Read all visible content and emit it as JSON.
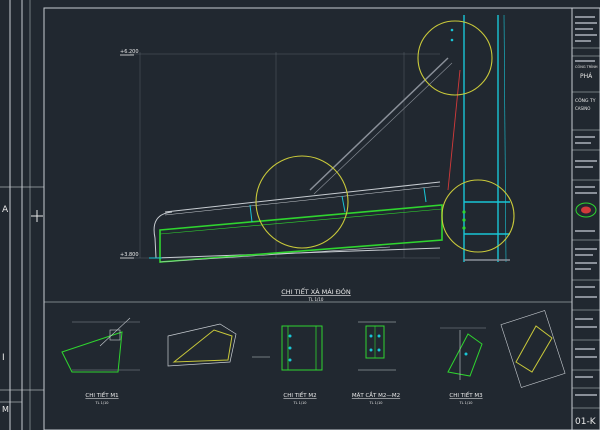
{
  "app": {
    "background": "#212830"
  },
  "colors": {
    "frame": "#c8cdd2",
    "beam_green": "#2fd52f",
    "detail_circle": "#c9c93a",
    "column_cyan": "#19c6d6",
    "tie_red": "#d23a3a",
    "text_white": "#e8e8e8",
    "dim_gray": "#8a9099"
  },
  "main_drawing": {
    "title": "CHI TIẾT XÀ MÁI ĐÓN",
    "scale": "TL 1/10",
    "level_top": "+6.200",
    "level_bottom": "+3.800"
  },
  "detail_views": [
    {
      "title": "CHI TIẾT M1",
      "scale": "TL 1/10"
    },
    {
      "title": "CHI TIẾT M2",
      "scale": "TL 1/10"
    },
    {
      "title": "MẶT CẮT M2—M2",
      "scale": "TL 1/10"
    },
    {
      "title": "CHI TIẾT M3",
      "scale": "TL 1/10"
    }
  ],
  "title_block": {
    "project_label": "CÔNG TRÌNH",
    "project_name": "PHÁ",
    "drawing_code": "01-K",
    "company_label": "CÔNG TY",
    "company_name": "CASINO"
  }
}
